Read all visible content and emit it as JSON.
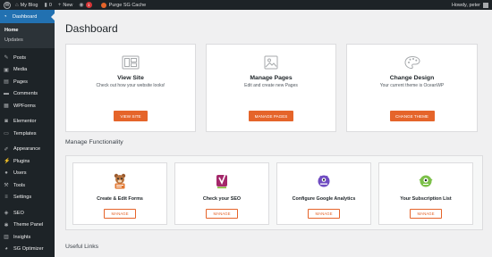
{
  "adminbar": {
    "site_name": "My Blog",
    "comments_count": "0",
    "new_label": "New",
    "notification_count": "1",
    "cache_label": "Purge SG Cache",
    "howdy": "Howdy, peter"
  },
  "sidebar": {
    "dashboard": "Dashboard",
    "submenu": [
      "Home",
      "Updates"
    ],
    "items": [
      {
        "label": "Posts",
        "icon": "pin-icon"
      },
      {
        "label": "Media",
        "icon": "media-icon"
      },
      {
        "label": "Pages",
        "icon": "page-icon"
      },
      {
        "label": "Comments",
        "icon": "comment-icon"
      },
      {
        "label": "WPForms",
        "icon": "form-icon"
      },
      {
        "label": "Elementor",
        "icon": "elementor-icon"
      },
      {
        "label": "Templates",
        "icon": "folder-icon"
      },
      {
        "label": "Appearance",
        "icon": "brush-icon"
      },
      {
        "label": "Plugins",
        "icon": "plug-icon"
      },
      {
        "label": "Users",
        "icon": "user-icon"
      },
      {
        "label": "Tools",
        "icon": "wrench-icon"
      },
      {
        "label": "Settings",
        "icon": "sliders-icon"
      },
      {
        "label": "SEO",
        "icon": "seo-icon"
      },
      {
        "label": "Theme Panel",
        "icon": "gear-icon"
      },
      {
        "label": "Insights",
        "icon": "chart-icon"
      },
      {
        "label": "SG Optimizer",
        "icon": "sg-icon"
      }
    ]
  },
  "main": {
    "title": "Dashboard",
    "cards": [
      {
        "title": "View Site",
        "subtitle": "Check out how your website looks!",
        "button": "VIEW SITE"
      },
      {
        "title": "Manage Pages",
        "subtitle": "Edit and create new Pages",
        "button": "MANAGE PAGES"
      },
      {
        "title": "Change Design",
        "subtitle": "Your current theme is OceanWP",
        "button": "CHANGE THEME"
      }
    ],
    "functionality_label": "Manage Functionality",
    "functions": [
      {
        "title": "Create & Edit Forms",
        "button": "MANAGE"
      },
      {
        "title": "Check your SEO",
        "button": "MANAGE"
      },
      {
        "title": "Configure Google Analytics",
        "button": "MANAGE"
      },
      {
        "title": "Your Subscription List",
        "button": "MANAGE"
      }
    ],
    "links_label": "Useful Links"
  },
  "colors": {
    "accent": "#e5642a",
    "admin_bg": "#1d2327",
    "active_menu": "#2271b1",
    "page_bg": "#f0f0f1"
  }
}
